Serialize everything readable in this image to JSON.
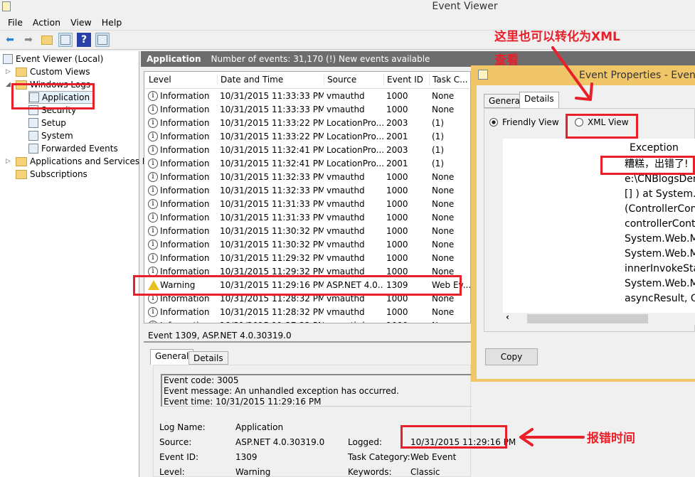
{
  "window": {
    "title": "Event Viewer"
  },
  "menu": [
    "File",
    "Action",
    "View",
    "Help"
  ],
  "toolbar": [
    "back-icon",
    "forward-icon",
    "open-folder-icon",
    "show-scope-icon",
    "help-icon",
    "show-action-pane-icon"
  ],
  "tree": [
    {
      "label": "Event Viewer (Local)",
      "indent": 0,
      "icon": "event-log-icon"
    },
    {
      "label": "Custom Views",
      "indent": 1,
      "icon": "folder-filter-icon",
      "expander": "▷"
    },
    {
      "label": "Windows Logs",
      "indent": 1,
      "icon": "folder-icon",
      "expander": "◢"
    },
    {
      "label": "Application",
      "indent": 2,
      "icon": "log-warning-icon",
      "selected": true
    },
    {
      "label": "Security",
      "indent": 2,
      "icon": "log-icon"
    },
    {
      "label": "Setup",
      "indent": 2,
      "icon": "log-icon"
    },
    {
      "label": "System",
      "indent": 2,
      "icon": "log-warning-icon"
    },
    {
      "label": "Forwarded Events",
      "indent": 2,
      "icon": "log-icon"
    },
    {
      "label": "Applications and Services Lo",
      "indent": 1,
      "icon": "folder-icon",
      "expander": "▷"
    },
    {
      "label": "Subscriptions",
      "indent": 1,
      "icon": "subscriptions-icon"
    }
  ],
  "header": {
    "title": "Application",
    "count": "Number of events: 31,170 (!) New events available"
  },
  "columns": [
    "Level",
    "Date and Time",
    "Source",
    "Event ID",
    "Task C..."
  ],
  "rows": [
    [
      "Information",
      "10/31/2015 11:33:33 PM",
      "vmauthd",
      "1000",
      "None"
    ],
    [
      "Information",
      "10/31/2015 11:33:33 PM",
      "vmauthd",
      "1000",
      "None"
    ],
    [
      "Information",
      "10/31/2015 11:33:22 PM",
      "LocationPro...",
      "2003",
      "(1)"
    ],
    [
      "Information",
      "10/31/2015 11:33:22 PM",
      "LocationPro...",
      "2001",
      "(1)"
    ],
    [
      "Information",
      "10/31/2015 11:32:41 PM",
      "LocationPro...",
      "2003",
      "(1)"
    ],
    [
      "Information",
      "10/31/2015 11:32:41 PM",
      "LocationPro...",
      "2001",
      "(1)"
    ],
    [
      "Information",
      "10/31/2015 11:32:33 PM",
      "vmauthd",
      "1000",
      "None"
    ],
    [
      "Information",
      "10/31/2015 11:32:33 PM",
      "vmauthd",
      "1000",
      "None"
    ],
    [
      "Information",
      "10/31/2015 11:31:33 PM",
      "vmauthd",
      "1000",
      "None"
    ],
    [
      "Information",
      "10/31/2015 11:31:33 PM",
      "vmauthd",
      "1000",
      "None"
    ],
    [
      "Information",
      "10/31/2015 11:30:32 PM",
      "vmauthd",
      "1000",
      "None"
    ],
    [
      "Information",
      "10/31/2015 11:30:32 PM",
      "vmauthd",
      "1000",
      "None"
    ],
    [
      "Information",
      "10/31/2015 11:29:32 PM",
      "vmauthd",
      "1000",
      "None"
    ],
    [
      "Information",
      "10/31/2015 11:29:32 PM",
      "vmauthd",
      "1000",
      "None"
    ],
    [
      "Warning",
      "10/31/2015 11:29:16 PM",
      "ASP.NET 4.0....",
      "1309",
      "Web Ev..."
    ],
    [
      "Information",
      "10/31/2015 11:28:32 PM",
      "vmauthd",
      "1000",
      "None"
    ],
    [
      "Information",
      "10/31/2015 11:28:32 PM",
      "vmauthd",
      "1000",
      "None"
    ],
    [
      "Information",
      "10/31/2015 11:27:32 PM",
      "vmauthd",
      "1000",
      "None"
    ]
  ],
  "event": {
    "title": "Event 1309, ASP.NET 4.0.30319.0",
    "tabs": [
      "General",
      "Details"
    ],
    "message": [
      "Event code: 3005",
      "Event message: An unhandled exception has occurred.",
      "Event time: 10/31/2015 11:29:16 PM"
    ],
    "fields": [
      [
        "Log Name:",
        "Application"
      ],
      [
        "Source:",
        "ASP.NET 4.0.30319.0"
      ],
      [
        "Event ID:",
        "1309"
      ],
      [
        "Level:",
        "Warning"
      ]
    ],
    "fields2": [
      [
        "Logged:",
        "10/31/2015 11:29:16 PM"
      ],
      [
        "Task Category:",
        "Web Event"
      ],
      [
        "Keywords:",
        "Classic"
      ]
    ]
  },
  "dialog": {
    "title": "Event Properties - Event",
    "tabs": [
      "General",
      "Details"
    ],
    "friendly": "Friendly View",
    "xml": "XML View",
    "heading": "Exception",
    "lines": [
      "糟糕，出错了!",
      "e:\\CNBlogsDem",
      "[] ) at System.W",
      "(ControllerConte",
      "controllerContex",
      "System.Web.Mv",
      "System.Web.Mv",
      "innerInvokeStat",
      "System.Web.Mv",
      "asyncResult, Ob"
    ],
    "copy": "Copy"
  },
  "annotations": {
    "xml_note_1": "这里也可以转化为XML",
    "xml_note_2": "查看",
    "time_note": "报错时间"
  },
  "colors": {
    "annotation": "#e8202a",
    "dialog_border": "#f0c668",
    "header": "#6d6d6d"
  }
}
